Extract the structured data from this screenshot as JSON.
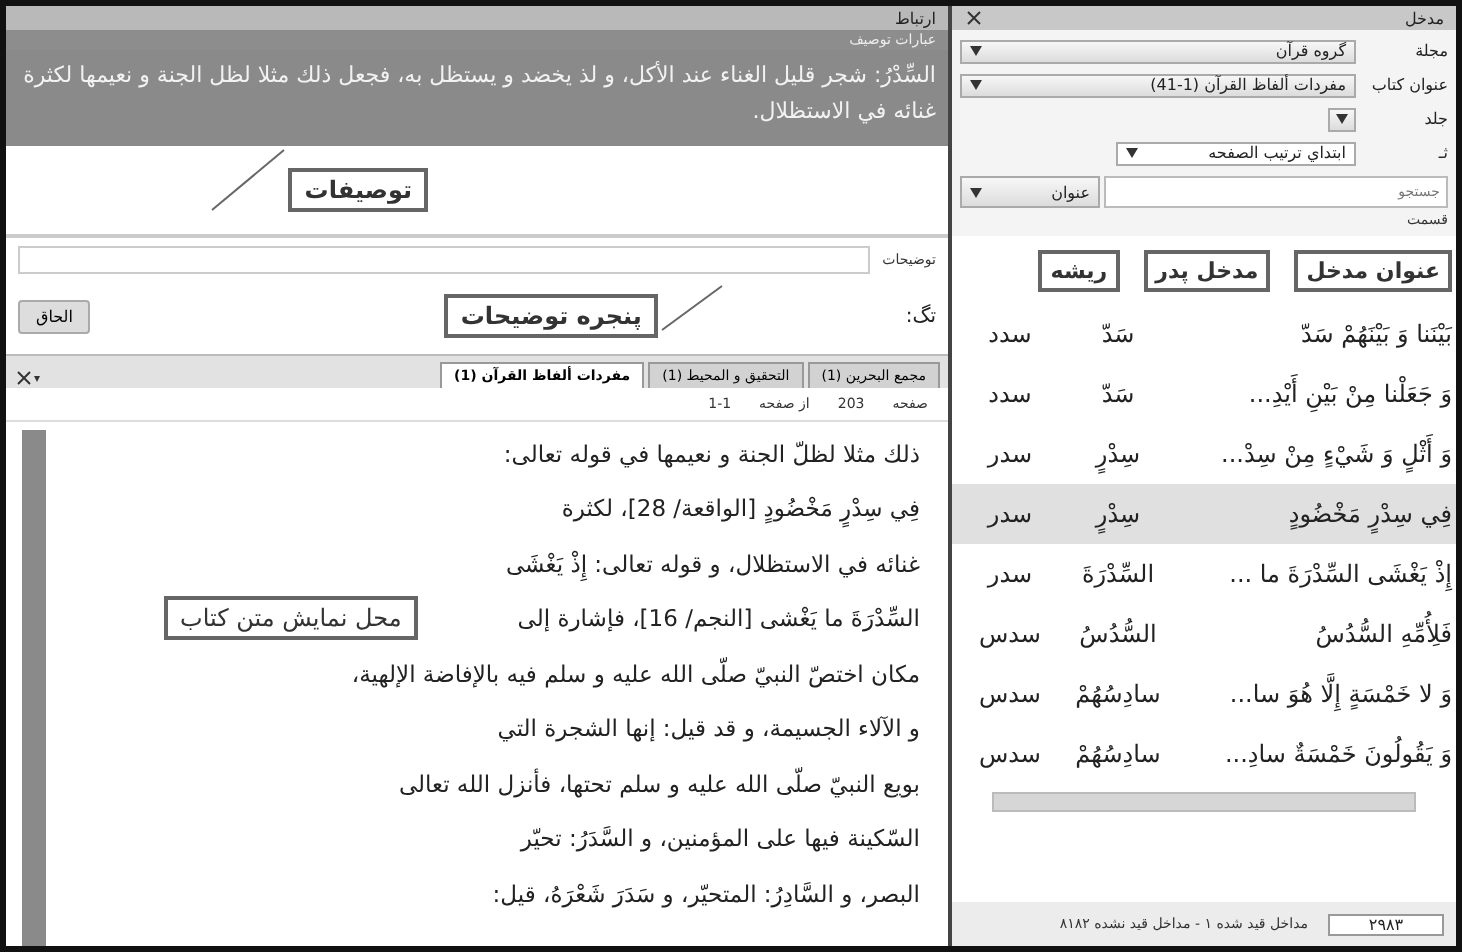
{
  "left_pane": {
    "title": "ارتباط",
    "subtitle": "عبارات توصيف",
    "description": "السِّدْرُ: شجر قليل الغناء عند الأكل، و لذ يخضد و يستظل به، فجعل ذلك مثلا لظل الجنة و نعيمها لكثرة غنائه في الاستظلال.",
    "callout_description": "توصيفات",
    "notes_label": "توضیحات",
    "callout_notes": "پنجره توضیحات",
    "tag_label": "تگ:",
    "attach_button": "الحاق",
    "tabs": [
      {
        "label": "مجمع البحرين (1)",
        "selected": false
      },
      {
        "label": "التحقيق و المحيط (1)",
        "selected": false
      },
      {
        "label": "مفردات ألفاظ القرآن (1)",
        "selected": true
      }
    ],
    "pager": {
      "page_label": "صفحه",
      "page_value": "203",
      "total_label": "از صفحه",
      "total_value": "1-1"
    },
    "book_text_lines": [
      "ذلك مثلا لظلّ الجنة و نعيمها في قوله تعالى:",
      "فِي سِدْرٍ مَخْضُودٍ [الواقعة/ 28]، لكثرة",
      "غنائه في الاستظلال، و قوله تعالى: إِذْ يَغْشَى",
      "السِّدْرَةَ ما يَغْشى [النجم/ 16]، فإشارة إلى",
      "مكان اختصّ النبيّ صلّى الله عليه و سلم فيه بالإفاضة الإلهية،",
      "و الآلاء الجسيمة، و قد قيل: إنها الشجرة التي",
      "بويع النبيّ صلّى الله عليه و سلم تحتها، فأنزل الله تعالى",
      "السّكينة فيها على المؤمنين، و السَّدَرُ: تحيّر",
      "البصر، و السَّادِرُ: المتحيّر، و سَدَرَ شَعْرَهُ، قيل:"
    ],
    "callout_text": "محل نمایش متن کتاب"
  },
  "right_pane": {
    "title": "مدخل",
    "fields": [
      {
        "label": "مجلة",
        "value": "گروه قرآن",
        "kind": "wide"
      },
      {
        "label": "عنوان کتاب",
        "value": "مفردات ألفاظ القرآن (1-41)",
        "kind": "wide"
      },
      {
        "label": "جلد",
        "kind": "small"
      },
      {
        "label": "ثـ",
        "value": "ابتداي ترتيب الصفحه",
        "kind": "medium"
      }
    ],
    "search": {
      "placeholder": "جستجو",
      "scope": "عنوان"
    },
    "section_label": "قسمت",
    "columns": [
      "عنوان مدخل",
      "مدخل پدر",
      "ريشه"
    ],
    "rows": [
      {
        "title": "بَيْنَنا وَ بَيْنَهُمْ سَدّ",
        "parent": "سَدّ",
        "root": "سدد",
        "selected": false
      },
      {
        "title": "وَ جَعَلْنا مِنْ بَيْنِ أَيْدِ...",
        "parent": "سَدّ",
        "root": "سدد",
        "selected": false
      },
      {
        "title": "وَ أَثْلٍ وَ شَيْءٍ مِنْ سِدْ...",
        "parent": "سِدْرٍ",
        "root": "سدر",
        "selected": false
      },
      {
        "title": "فِي سِدْرٍ مَخْضُودٍ",
        "parent": "سِدْرٍ",
        "root": "سدر",
        "selected": true
      },
      {
        "title": "إِذْ يَغْشَى السِّدْرَةَ ما ...",
        "parent": "السِّدْرَةَ",
        "root": "سدر",
        "selected": false
      },
      {
        "title": "فَلِأُمِّهِ السُّدُسُ",
        "parent": "السُّدُسُ",
        "root": "سدس",
        "selected": false
      },
      {
        "title": "وَ لا خَمْسَةٍ إِلَّا هُوَ سا...",
        "parent": "سادِسُهُمْ",
        "root": "سدس",
        "selected": false
      },
      {
        "title": "وَ يَقُولُونَ خَمْسَةٌ سادِ...",
        "parent": "سادِسُهُمْ",
        "root": "سدس",
        "selected": false
      }
    ],
    "status_count": "٢٩٨٣",
    "status_text": "مداخل قید شده ۱ - مداخل قید نشده ۸۱۸۲"
  }
}
